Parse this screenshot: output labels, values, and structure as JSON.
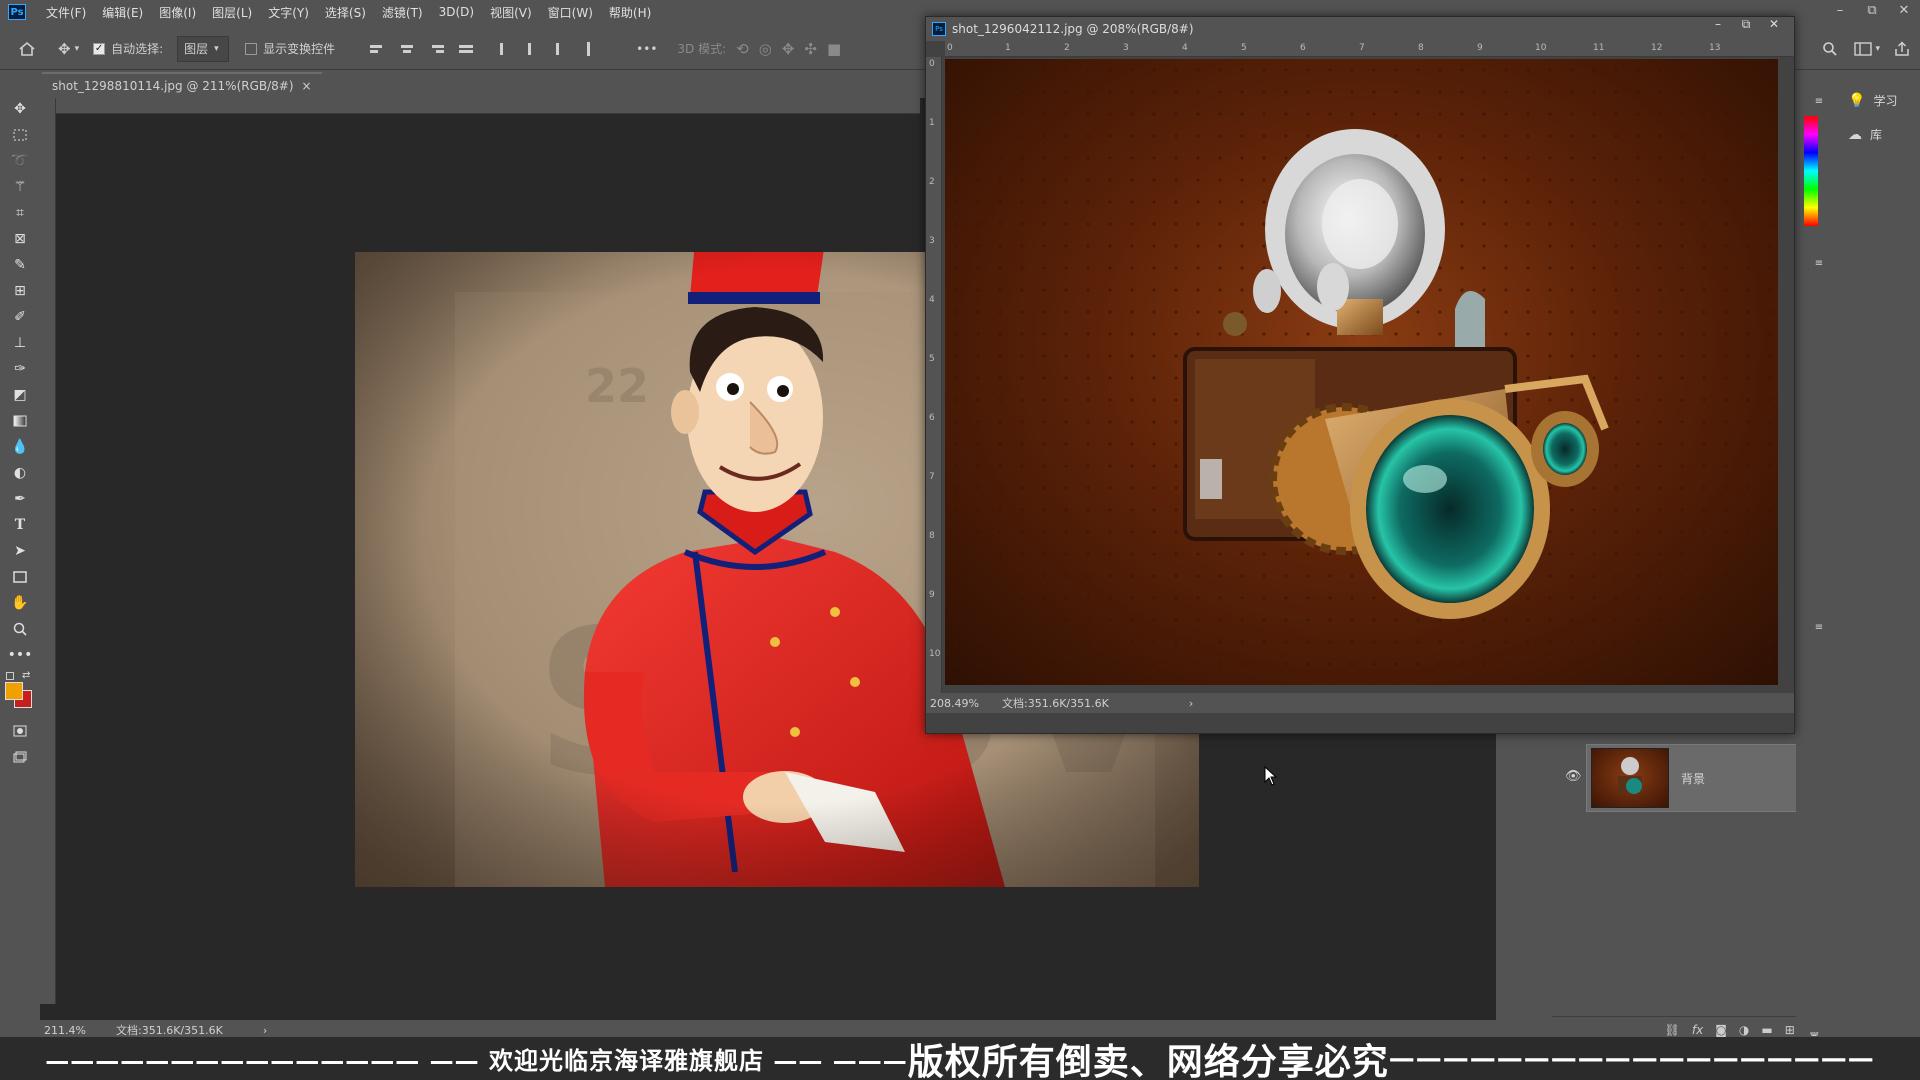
{
  "app": {
    "logo": "Ps"
  },
  "menu": [
    "文件(F)",
    "编辑(E)",
    "图像(I)",
    "图层(L)",
    "文字(Y)",
    "选择(S)",
    "滤镜(T)",
    "3D(D)",
    "视图(V)",
    "窗口(W)",
    "帮助(H)"
  ],
  "window_controls": {
    "minimize": "–",
    "restore": "⧉",
    "close": "✕"
  },
  "options_bar": {
    "auto_select_label": "自动选择:",
    "auto_select_checked": true,
    "layer_dropdown": "图层",
    "show_transform_label": "显示变换控件",
    "show_transform_checked": false,
    "more_label": "•••",
    "mode_3d_label": "3D 模式:"
  },
  "document": {
    "tab_title": "shot_1298810114.jpg @ 211%(RGB/8#)",
    "tab_close": "×",
    "zoom": "211.4%",
    "doc_size": "文档:351.6K/351.6K",
    "status_arrow": "›"
  },
  "floating_document": {
    "title": "shot_1296042112.jpg @ 208%(RGB/8#)",
    "zoom": "208.49%",
    "doc_size": "文档:351.6K/351.6K",
    "status_arrow": "›",
    "h_ruler": [
      "0",
      "1",
      "2",
      "3",
      "4",
      "5",
      "6",
      "7",
      "8",
      "9",
      "10",
      "11",
      "12",
      "13"
    ],
    "v_ruler": [
      "0",
      "1",
      "2",
      "3",
      "4",
      "5",
      "6",
      "7",
      "8",
      "9",
      "10"
    ]
  },
  "right_panel": {
    "learn_label": "学习",
    "library_label": "库"
  },
  "layers_panel": {
    "layers": [
      {
        "name": "背景",
        "visible": true,
        "locked": true
      }
    ],
    "footer_icons": [
      "link-icon",
      "fx-icon",
      "mask-icon",
      "adjustment-icon",
      "folder-icon",
      "new-layer-icon",
      "trash-icon"
    ]
  },
  "watermark": {
    "left": "——————————————— —— 欢迎光临京海译雅旗舰店 —— ———",
    "center": "版权所有倒卖、网络分享必究",
    "right": "——————————————————"
  },
  "colors": {
    "foreground": "#f0a000",
    "background": "#c81e1e",
    "ui_bg": "#535353",
    "canvas_bg": "#282828"
  }
}
